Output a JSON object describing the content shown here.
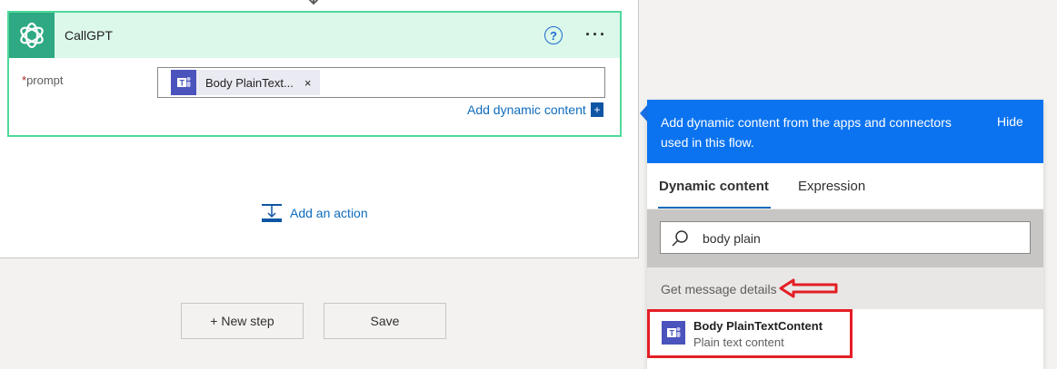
{
  "action_card": {
    "title": "CallGPT",
    "prompt_label": "prompt",
    "required_marker": "*",
    "token_label": "Body PlainText...",
    "token_remove": "×",
    "add_dynamic_label": "Add dynamic content",
    "add_dynamic_plus": "+"
  },
  "add_action_label": "Add an action",
  "buttons": {
    "new_step": "+ New step",
    "save": "Save"
  },
  "dynamic_panel": {
    "header_text": "Add dynamic content from the apps and connectors used in this flow.",
    "hide_label": "Hide",
    "tabs": [
      {
        "label": "Dynamic content",
        "active": true
      },
      {
        "label": "Expression",
        "active": false
      }
    ],
    "search_value": "body plain",
    "group_title": "Get message details",
    "items": [
      {
        "title": "Body PlainTextContent",
        "subtitle": "Plain text content",
        "highlighted": true
      }
    ]
  },
  "colors": {
    "card_border": "#4fd89b",
    "card_header": "#dbf8ea",
    "accent_blue": "#0b73f0",
    "teams_purple": "#4b53bc",
    "annotation_red": "#e31e24"
  },
  "icons": {
    "card_logo": "openai-icon",
    "help": "help-icon",
    "more": "more-options-icon",
    "token": "teams-icon",
    "add_action": "add-action-icon",
    "search": "search-icon"
  }
}
